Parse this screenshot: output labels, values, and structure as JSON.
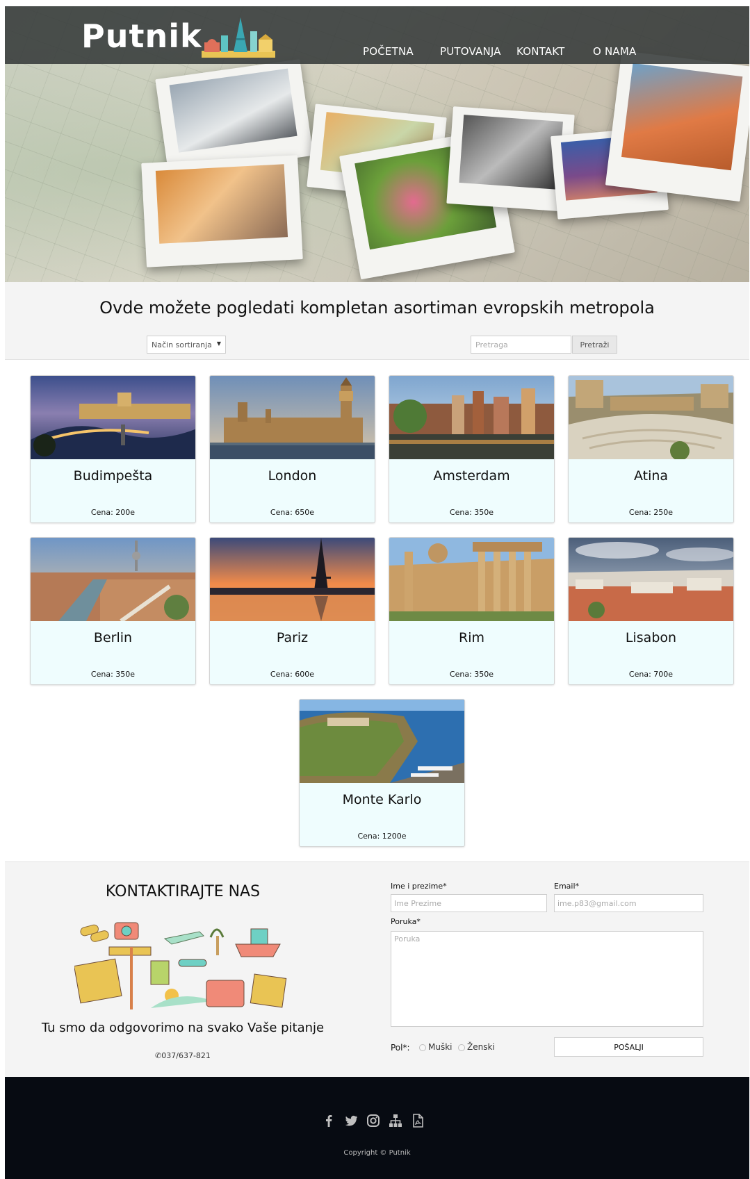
{
  "header": {
    "logo_text": "Putnik",
    "nav": [
      "POČETNA",
      "PUTOVANJA",
      "KONTAKT",
      "O NAMA"
    ]
  },
  "intro": {
    "title": "Ovde možete pogledati kompletan asortiman evropskih metropola",
    "sort_label": "Način sortiranja",
    "search_placeholder": "Pretraga",
    "search_button": "Pretraži"
  },
  "destinations": [
    {
      "name": "Budimpešta",
      "price": "Cena: 200e"
    },
    {
      "name": "London",
      "price": "Cena: 650e"
    },
    {
      "name": "Amsterdam",
      "price": "Cena: 350e"
    },
    {
      "name": "Atina",
      "price": "Cena: 250e"
    },
    {
      "name": "Berlin",
      "price": "Cena: 350e"
    },
    {
      "name": "Pariz",
      "price": "Cena: 600e"
    },
    {
      "name": "Rim",
      "price": "Cena: 350e"
    },
    {
      "name": "Lisabon",
      "price": "Cena: 700e"
    },
    {
      "name": "Monte Karlo",
      "price": "Cena: 1200e"
    }
  ],
  "contact": {
    "title": "KONTAKTIRAJTE NAS",
    "tagline": "Tu smo da odgovorimo na svako Vaše pitanje",
    "phone": "037/637-821",
    "form": {
      "name_label": "Ime i prezime*",
      "name_placeholder": "Ime Prezime",
      "email_label": "Email*",
      "email_placeholder": "ime.p83@gmail.com",
      "message_label": "Poruka*",
      "message_placeholder": "Poruka",
      "gender_label": "Pol*:",
      "gender_male": "Muški",
      "gender_female": "Ženski",
      "submit": "POŠALJI"
    }
  },
  "footer": {
    "social_icons": [
      "facebook-icon",
      "twitter-icon",
      "instagram-icon",
      "sitemap-icon",
      "pdf-icon"
    ],
    "copyright": "Copyright © Putnik"
  }
}
